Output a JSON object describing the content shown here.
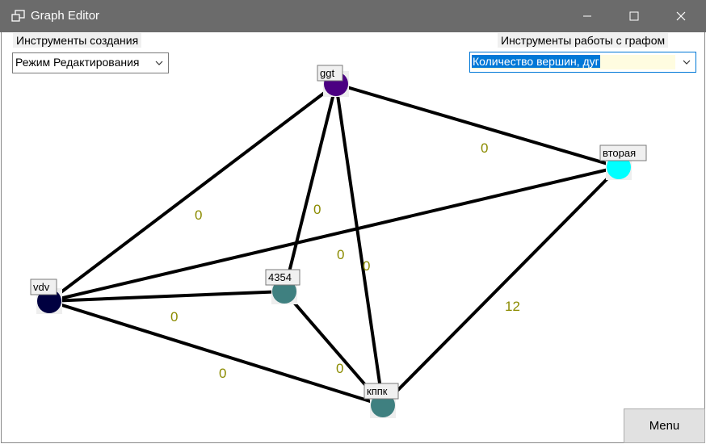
{
  "window": {
    "title": "Graph Editor",
    "minimize_icon": "minimize-icon",
    "maximize_icon": "maximize-icon",
    "close_icon": "close-icon"
  },
  "toolbar": {
    "create_tools_label": "Инструменты создания",
    "create_mode_value": "Режим Редактирования",
    "graph_tools_label": "Инструменты работы с графом",
    "graph_tool_value": "Количество вершин, дуг",
    "accent": "#0078d7"
  },
  "graph": {
    "vertices": [
      {
        "id": "ggt",
        "label": "ggt",
        "color": "#4b0082"
      },
      {
        "id": "vtoraya",
        "label": "вторая",
        "color": "#00ffff"
      },
      {
        "id": "vdv",
        "label": "vdv",
        "color": "#000040"
      },
      {
        "id": "n4354",
        "label": "4354",
        "color": "#3f8080"
      },
      {
        "id": "kppk",
        "label": "кппк",
        "color": "#3f8080"
      }
    ],
    "edges": [
      {
        "from": "vdv",
        "to": "ggt",
        "weight": "0"
      },
      {
        "from": "ggt",
        "to": "vtoraya",
        "weight": "0"
      },
      {
        "from": "ggt",
        "to": "n4354",
        "weight": "0"
      },
      {
        "from": "ggt",
        "to": "kppk",
        "weight": "0"
      },
      {
        "from": "vdv",
        "to": "vtoraya",
        "weight": "0"
      },
      {
        "from": "vdv",
        "to": "n4354",
        "weight": "0"
      },
      {
        "from": "vdv",
        "to": "kppk",
        "weight": "0"
      },
      {
        "from": "n4354",
        "to": "kppk",
        "weight": "0"
      },
      {
        "from": "vtoraya",
        "to": "kppk",
        "weight": "12"
      }
    ]
  },
  "footer": {
    "menu_label": "Menu"
  }
}
